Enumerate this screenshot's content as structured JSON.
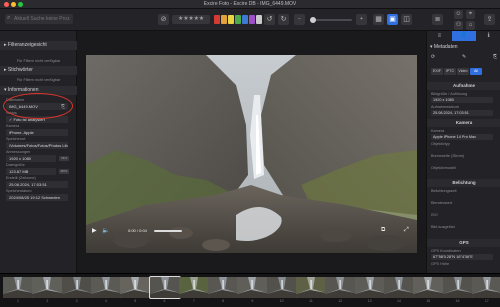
{
  "window": {
    "title": "Excire Foto - Excire DB - IMG_6449.MOV"
  },
  "toolbar": {
    "search_placeholder": "Aktuell Suche keine Prozess",
    "stars": "★★★★★",
    "color_labels": [
      "#d33b33",
      "#e2a33c",
      "#e8d544",
      "#4caa48",
      "#3d7ad6",
      "#9d4fc8",
      "#c9c9cc"
    ]
  },
  "left_panel": {
    "sections": {
      "filter": "Filteranzeigesicht",
      "stichworte": "Stichwörter",
      "info": "Informationen"
    },
    "hint_filter": "Für Filtern nicht verfügbar",
    "hint_stichworte": "Für Filtern nicht verfügbar",
    "fields": [
      {
        "label": "Dateiname",
        "value": "IMG_6449.MOV"
      },
      {
        "label": "Status",
        "value": "✓  Foto ist analysiert"
      },
      {
        "label": "Kamera",
        "value": "iPhone, Apple"
      },
      {
        "label": "Speicherort",
        "value": "/Volumes/Fotos/Fotos/Photos Lib..."
      },
      {
        "label": "Abmessungen",
        "value": "1920 x 1080"
      },
      {
        "label": "Dateigröße",
        "value": "123.87 MB"
      },
      {
        "label": "Erstellt (Zeitzone)",
        "value": "25.08.2024, 17:03:51"
      },
      {
        "label": "Speicherdatum",
        "value": "2024/08/25 19:12 Schweden"
      }
    ],
    "badges": [
      "16:9",
      "MOV"
    ]
  },
  "viewer": {
    "time": "0:00 / 0:04",
    "video_filename": "IMG_6449.MOV"
  },
  "right_panel": {
    "tabs": [
      "≡",
      "👤",
      "ℹ"
    ],
    "section_title": "Metadaten",
    "meta_tabs": [
      "EXIF",
      "IPTC",
      "Video",
      "All"
    ],
    "section_aufnahme": "Aufnahme",
    "section_kamera": "Kamera",
    "section_belichtung": "Belichtung",
    "section_gps": "GPS",
    "fields": [
      {
        "label": "Bildgröße / Auflösung",
        "value": "1920 x 1080"
      },
      {
        "label": "Aufnahmedatum",
        "value": "25.08.2024, 17:03:51"
      },
      {
        "label": "Kamera",
        "value": "Apple iPhone 14 Pro Max"
      },
      {
        "label": "Objektivtyp",
        "value": ""
      },
      {
        "label": "Brennweite (35mm)",
        "value": ""
      },
      {
        "label": "Objektivmodell",
        "value": ""
      },
      {
        "label": "Belichtungszeit",
        "value": ""
      },
      {
        "label": "Blendenwert",
        "value": ""
      },
      {
        "label": "ISO",
        "value": ""
      },
      {
        "label": "Bild ausgelöst",
        "value": ""
      },
      {
        "label": "GPS Koordinaten",
        "value": "67°58'0.28\"N 16°4'36\"E"
      },
      {
        "label": "GPS Höhe",
        "value": ""
      }
    ]
  },
  "filmstrip": {
    "numbers": [
      "1",
      "2",
      "3",
      "4",
      "5",
      "6",
      "7",
      "8",
      "9",
      "10",
      "11",
      "12",
      "13",
      "14",
      "15",
      "16",
      "17"
    ]
  }
}
